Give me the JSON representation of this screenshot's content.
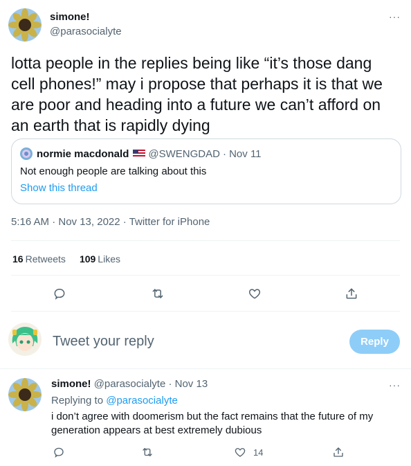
{
  "main_tweet": {
    "author_name": "simone!",
    "author_handle": "@parasocialyte",
    "more_label": "···",
    "text": "lotta people in the replies being like “it’s those dang cell phones!” may i propose that perhaps it is that we are poor and heading into a future we can’t afford on an earth that is rapidly dying",
    "quote": {
      "author_name": "normie macdonald",
      "author_handle": "@SWENGDAD",
      "date": "· Nov 11",
      "text": "Not enough people are talking about this",
      "show_thread": "Show this thread"
    },
    "timestamp": "5:16 AM · Nov 13, 2022 · Twitter for iPhone",
    "retweets_count": "16",
    "retweets_label": "Retweets",
    "likes_count": "109",
    "likes_label": "Likes"
  },
  "compose": {
    "placeholder": "Tweet your reply",
    "reply_button": "Reply"
  },
  "reply_tweet": {
    "author_name": "simone!",
    "author_handle": "@parasocialyte",
    "date": "· Nov 13",
    "more_label": "···",
    "replying_prefix": "Replying to",
    "replying_to": "@parasocialyte",
    "text": "i don’t agree with doomerism but the fact remains that the future of my generation appears at best extremely dubious",
    "like_count": "14"
  },
  "icons": {
    "reply": "comment-icon",
    "retweet": "retweet-icon",
    "like": "heart-icon",
    "share": "share-icon"
  },
  "colors": {
    "accent": "#1d9bf0",
    "reply_button": "#8ecdf8",
    "muted_text": "#536471",
    "border": "#cfd9de"
  }
}
